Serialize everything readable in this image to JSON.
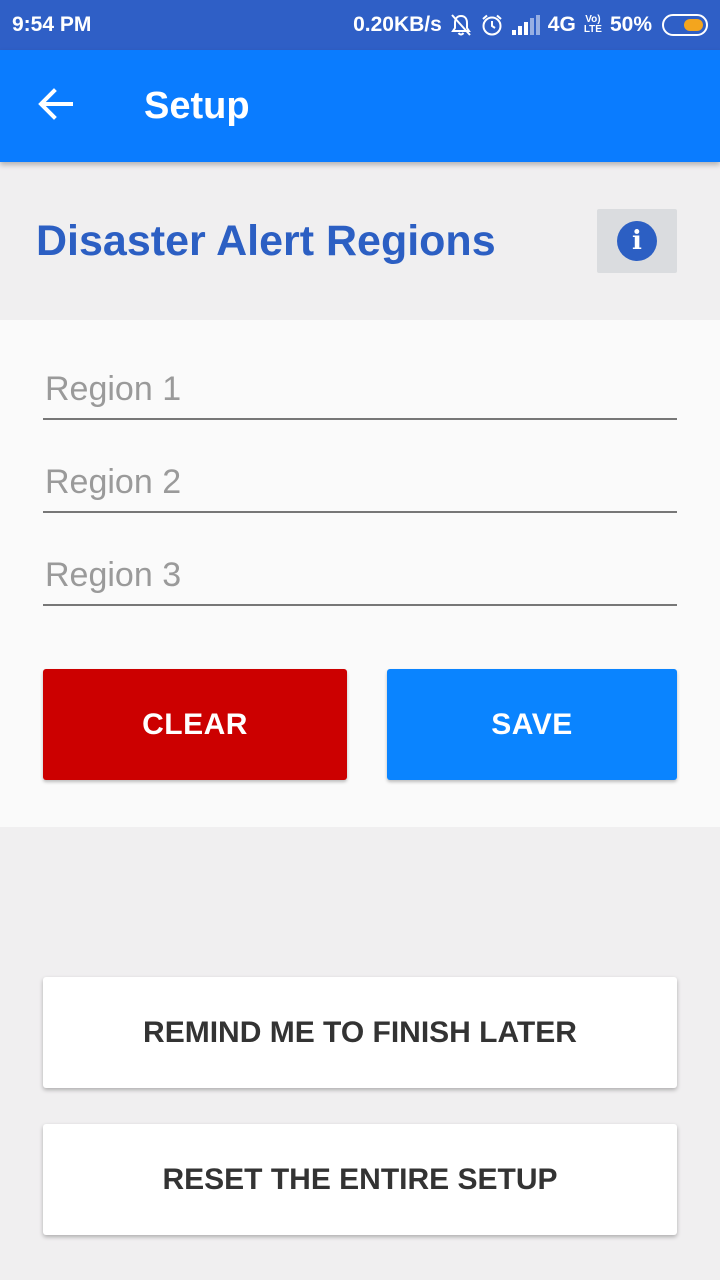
{
  "status_bar": {
    "time": "9:54 PM",
    "speed": "0.20KB/s",
    "network": "4G",
    "volte_top": "Vo)",
    "volte_bottom": "LTE",
    "battery": "50%",
    "battery_level": 0.5,
    "icons": [
      "mute-bell-icon",
      "alarm-icon",
      "signal-icon",
      "battery-icon"
    ]
  },
  "app_bar": {
    "title": "Setup",
    "back_icon": "arrow-left-icon"
  },
  "section": {
    "title": "Disaster Alert Regions",
    "info_icon": "info-icon",
    "info_glyph": "i"
  },
  "form": {
    "fields": [
      {
        "placeholder": "Region 1",
        "value": ""
      },
      {
        "placeholder": "Region 2",
        "value": ""
      },
      {
        "placeholder": "Region 3",
        "value": ""
      }
    ],
    "clear_label": "CLEAR",
    "save_label": "SAVE"
  },
  "actions": {
    "remind_label": "REMIND ME TO FINISH LATER",
    "reset_label": "RESET THE ENTIRE SETUP"
  },
  "colors": {
    "status_bar": "#2f5fc6",
    "app_bar": "#0a7cff",
    "title_blue": "#2c5fc3",
    "clear_red": "#cc0000",
    "save_blue": "#0a84ff"
  }
}
